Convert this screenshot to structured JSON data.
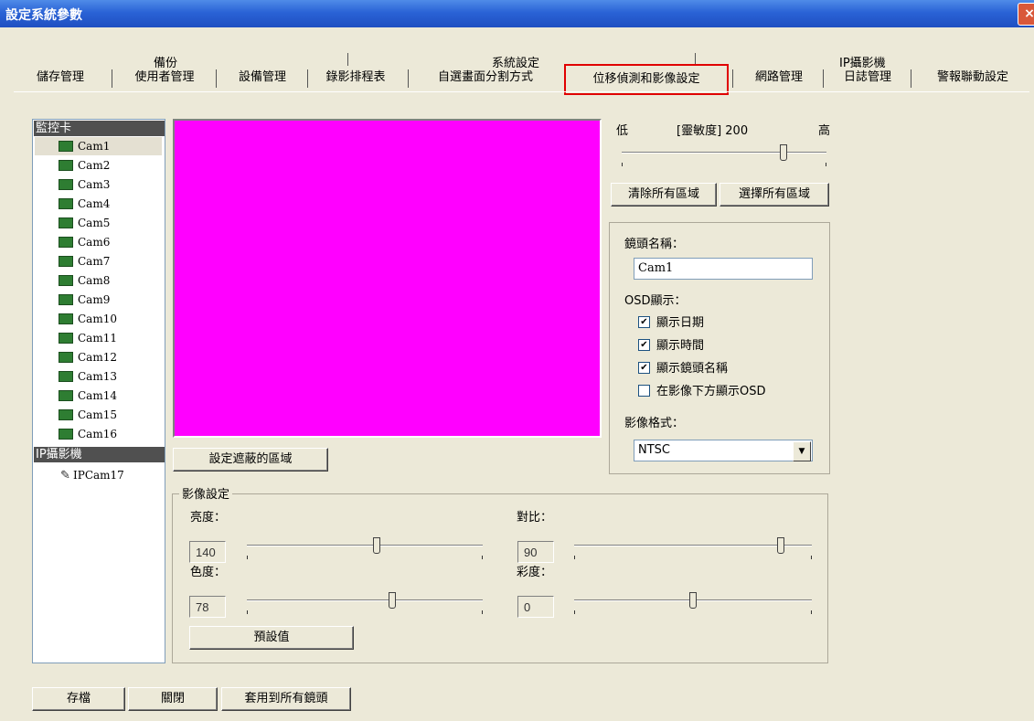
{
  "window": {
    "title": "設定系統參數",
    "close_icon": "×"
  },
  "tab_groups": [
    "備份",
    "系統設定",
    "IP攝影機"
  ],
  "tabs": [
    "儲存管理",
    "使用者管理",
    "設備管理",
    "錄影排程表",
    "自選畫面分割方式",
    "位移偵測和影像設定",
    "網路管理",
    "日誌管理",
    "警報聯動設定"
  ],
  "active_tab": "位移偵測和影像設定",
  "tree": {
    "header1": "監控卡",
    "cams": [
      "Cam1",
      "Cam2",
      "Cam3",
      "Cam4",
      "Cam5",
      "Cam6",
      "Cam7",
      "Cam8",
      "Cam9",
      "Cam10",
      "Cam11",
      "Cam12",
      "Cam13",
      "Cam14",
      "Cam15",
      "Cam16"
    ],
    "header2": "IP攝影機",
    "ipcams": [
      "IPCam17"
    ]
  },
  "preview": {
    "color": "#FF00FF"
  },
  "mask_button": "設定遮蔽的區域",
  "sensitivity": {
    "low": "低",
    "label": "[靈敏度] 200",
    "high": "高",
    "level": 0.8
  },
  "clear_all": "清除所有區域",
  "select_all": "選擇所有區域",
  "camera": {
    "name_label": "鏡頭名稱：",
    "name_value": "Cam1",
    "osd_label": "OSD顯示：",
    "osd": [
      {
        "label": "顯示日期",
        "checked": true,
        "mark": "✔"
      },
      {
        "label": "顯示時間",
        "checked": true,
        "mark": "✔"
      },
      {
        "label": "顯示鏡頭名稱",
        "checked": true,
        "mark": "✔"
      },
      {
        "label": "在影像下方顯示OSD",
        "checked": false,
        "mark": ""
      }
    ],
    "format_label": "影像格式：",
    "format_value": "NTSC"
  },
  "image_settings": {
    "title": "影像設定",
    "brightness_label": "亮度：",
    "brightness": "140",
    "brightness_level": 0.55,
    "contrast_label": "對比：",
    "contrast": "90",
    "contrast_level": 0.88,
    "hue_label": "色度：",
    "hue": "78",
    "hue_level": 0.62,
    "saturation_label": "彩度：",
    "saturation": "0",
    "saturation_level": 0.5,
    "default_button": "預設值"
  },
  "footer": {
    "save": "存檔",
    "close": "關閉",
    "apply_all": "套用到所有鏡頭"
  }
}
